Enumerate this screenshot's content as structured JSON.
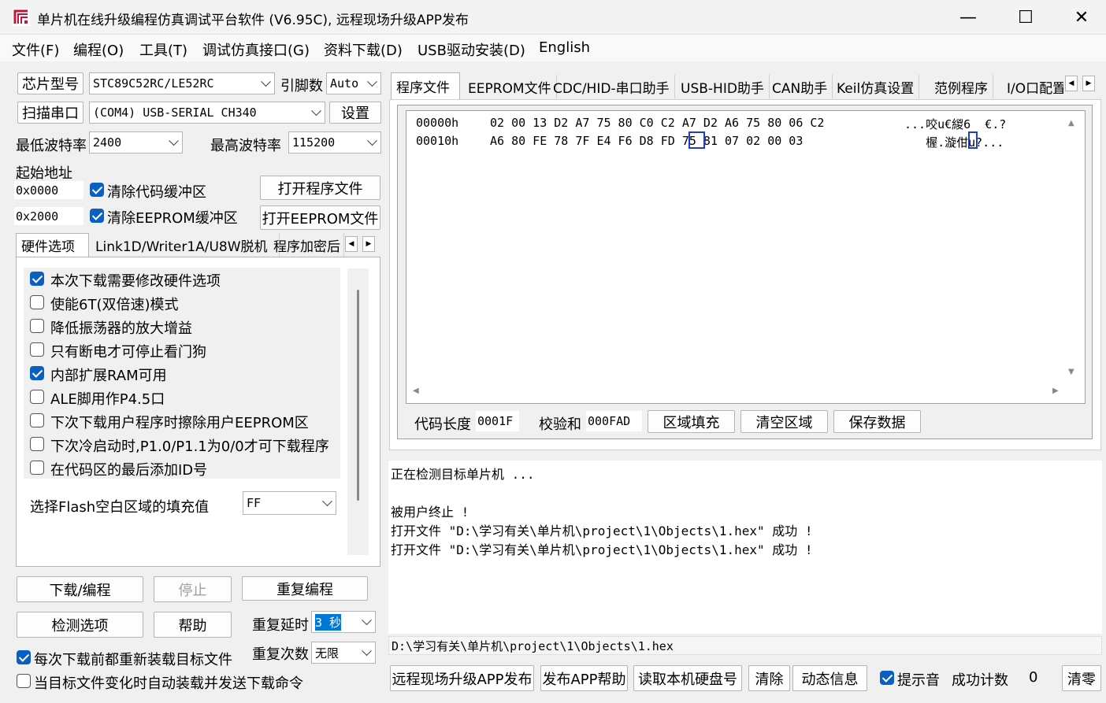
{
  "window": {
    "title": "单片机在线升级编程仿真调试平台软件 (V6.95C), 远程现场升级APP发布",
    "minimize": "—",
    "maximize": "☐",
    "close": "✕"
  },
  "menu": [
    "文件(F)",
    "编程(O)",
    "工具(T)",
    "调试仿真接口(G)",
    "资料下载(D)",
    "USB驱动安装(D)",
    "English"
  ],
  "left": {
    "chip_button": "芯片型号",
    "chip_value": "STC89C52RC/LE52RC",
    "freq_label": "引脚数",
    "freq_value": "Auto",
    "scan_button": "扫描串口",
    "port_value": "(COM4) USB-SERIAL CH340",
    "settings_button": "设置",
    "min_baud_label": "最低波特率",
    "min_baud_value": "2400",
    "max_baud_label": "最高波特率",
    "max_baud_value": "115200",
    "start_addr_label": "起始地址",
    "addr1": "0x0000",
    "clear_code_label": "清除代码缓冲区",
    "open_prog_button": "打开程序文件",
    "addr2": "0x2000",
    "clear_eeprom_label": "清除EEPROM缓冲区",
    "open_eeprom_button": "打开EEPROM文件",
    "tabs": [
      "硬件选项",
      "Link1D/Writer1A/U8W脱机",
      "程序加密后"
    ],
    "options": [
      {
        "label": "本次下载需要修改硬件选项",
        "checked": true
      },
      {
        "label": "使能6T(双倍速)模式",
        "checked": false
      },
      {
        "label": "降低振荡器的放大增益",
        "checked": false
      },
      {
        "label": "只有断电才可停止看门狗",
        "checked": false
      },
      {
        "label": "内部扩展RAM可用",
        "checked": true
      },
      {
        "label": "ALE脚用作P4.5口",
        "checked": false
      },
      {
        "label": "下次下载用户程序时擦除用户EEPROM区",
        "checked": false
      },
      {
        "label": "下次冷启动时,P1.0/P1.1为0/0才可下载程序",
        "checked": false
      },
      {
        "label": "在代码区的最后添加ID号",
        "checked": false
      }
    ],
    "fill_label": "选择Flash空白区域的填充值",
    "fill_value": "FF",
    "download_button": "下载/编程",
    "stop_button": "停止",
    "repeat_button": "重复编程",
    "check_button": "检测选项",
    "help_button": "帮助",
    "delay_label": "重复延时",
    "delay_value": "3 秒",
    "count_label": "重复次数",
    "count_value": "无限",
    "reload_label": "每次下载前都重新装载目标文件",
    "autoload_label": "当目标文件变化时自动装载并发送下载命令"
  },
  "right": {
    "tabs": [
      "程序文件",
      "EEPROM文件",
      "CDC/HID-串口助手",
      "USB-HID助手",
      "CAN助手",
      "Keil仿真设置",
      "范例程序",
      "I/O口配置"
    ],
    "hex_rows": [
      {
        "addr": "00000h",
        "bytes": "02 00 13 D2 A7 75 80 C0 C2 A7 D2 A6 75 80 06 C2",
        "ascii": "...咬u€緵6  €.?"
      },
      {
        "addr": "00010h",
        "bytes": "A6 80 FE 78 7F E4 F6 D8 FD 75 81 07 02 00 03",
        "ascii": "   楃.漩佄u?..."
      }
    ],
    "code_len_label": "代码长度",
    "code_len_value": "0001F",
    "checksum_label": "校验和",
    "checksum_value": "000FAD",
    "fill_region_button": "区域填充",
    "clear_region_button": "清空区域",
    "save_button": "保存数据",
    "log": [
      "正在检测目标单片机 ...",
      "",
      "被用户终止 !",
      "打开文件 \"D:\\学习有关\\单片机\\project\\1\\Objects\\1.hex\" 成功 !",
      "打开文件 \"D:\\学习有关\\单片机\\project\\1\\Objects\\1.hex\" 成功 !"
    ],
    "path": "D:\\学习有关\\单片机\\project\\1\\Objects\\1.hex",
    "publish_button": "远程现场升级APP发布",
    "publish_help_button": "发布APP帮助",
    "read_disk_button": "读取本机硬盘号",
    "clear_button": "清除",
    "dynamic_button": "动态信息",
    "sound_label": "提示音",
    "success_label": "成功计数",
    "success_value": "0",
    "reset_button": "清零"
  }
}
